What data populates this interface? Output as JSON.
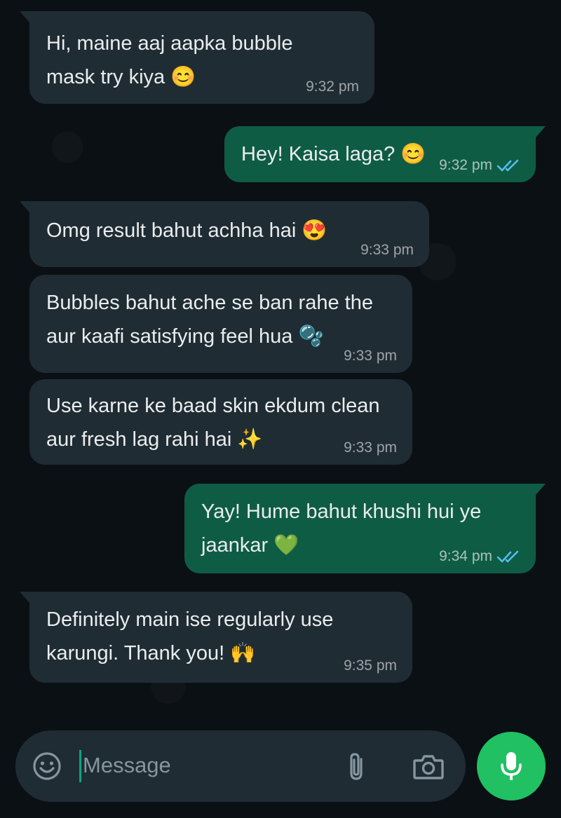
{
  "messages": [
    {
      "direction": "incoming",
      "text": "Hi, maine aaj aapka bubble\nmask try kiya 😊",
      "time": "9:32 pm"
    },
    {
      "direction": "outgoing",
      "text": "Hey! Kaisa laga? 😊",
      "time": "9:32 pm",
      "status": "read"
    },
    {
      "direction": "incoming",
      "text": "Omg result bahut achha hai 😍",
      "time": "9:33 pm"
    },
    {
      "direction": "incoming",
      "text": "Bubbles bahut ache se ban rahe the\naur kaafi satisfying feel hua 🫧",
      "time": "9:33 pm"
    },
    {
      "direction": "incoming",
      "text": "Use karne ke baad skin ekdum clean\naur fresh lag rahi hai ✨",
      "time": "9:33 pm"
    },
    {
      "direction": "outgoing",
      "text": "Yay! Hume bahut khushi hui ye\njaankar 💚",
      "time": "9:34 pm",
      "status": "read"
    },
    {
      "direction": "incoming",
      "text": "Definitely main ise regularly use\nkarungi. Thank you! 🙌",
      "time": "9:35 pm"
    }
  ],
  "composer": {
    "placeholder": "Message",
    "icons": [
      "emoji-icon",
      "attachment-icon",
      "camera-icon",
      "mic-icon"
    ]
  },
  "colors": {
    "background": "#0b1014",
    "incoming_bubble": "#202c33",
    "outgoing_bubble": "#0f5c45",
    "read_ticks": "#53bdeb",
    "mic_button": "#21c063"
  }
}
